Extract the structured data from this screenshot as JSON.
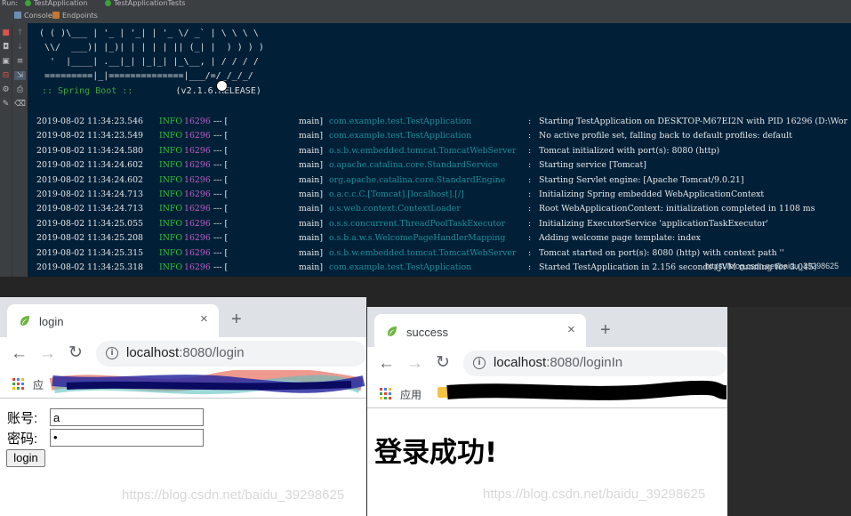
{
  "ide": {
    "run_label": "Run:",
    "run_tabs": [
      "TestApplication",
      "TestApplicationTests"
    ],
    "sub_tabs": [
      "Console",
      "Endpoints"
    ],
    "banner_lines": [
      "( ( )\\___ | '_ | '_| | '_ \\/ _` | \\ \\ \\ \\",
      " \\\\/  ___)| |_)| | | | | || (_| |  ) ) ) )",
      "  '  |____| .__|_| |_|_| |_\\__, | / / / /",
      " =========|_|==============|___/=/_/_/_/"
    ],
    "spring_label": ":: Spring Boot ::",
    "spring_version": "(v2.1.6.RELEASE)",
    "logs": [
      {
        "ts": "2019-08-02 11:34:23.546",
        "level": "INFO",
        "pid": "16296",
        "sep": "--- [",
        "thread": "main]",
        "logger": "com.example.test.TestApplication",
        "msg": "Starting TestApplication on DESKTOP-M67EI2N with PID 16296 (D:\\Wor"
      },
      {
        "ts": "2019-08-02 11:34:23.549",
        "level": "INFO",
        "pid": "16296",
        "sep": "--- [",
        "thread": "main]",
        "logger": "com.example.test.TestApplication",
        "msg": "No active profile set, falling back to default profiles: default"
      },
      {
        "ts": "2019-08-02 11:34:24.580",
        "level": "INFO",
        "pid": "16296",
        "sep": "--- [",
        "thread": "main]",
        "logger": "o.s.b.w.embedded.tomcat.TomcatWebServer",
        "msg": "Tomcat initialized with port(s): 8080 (http)"
      },
      {
        "ts": "2019-08-02 11:34:24.602",
        "level": "INFO",
        "pid": "16296",
        "sep": "--- [",
        "thread": "main]",
        "logger": "o.apache.catalina.core.StandardService",
        "msg": "Starting service [Tomcat]"
      },
      {
        "ts": "2019-08-02 11:34:24.602",
        "level": "INFO",
        "pid": "16296",
        "sep": "--- [",
        "thread": "main]",
        "logger": "org.apache.catalina.core.StandardEngine",
        "msg": "Starting Servlet engine: [Apache Tomcat/9.0.21]"
      },
      {
        "ts": "2019-08-02 11:34:24.713",
        "level": "INFO",
        "pid": "16296",
        "sep": "--- [",
        "thread": "main]",
        "logger": "o.a.c.c.C.[Tomcat].[localhost].[/]",
        "msg": "Initializing Spring embedded WebApplicationContext"
      },
      {
        "ts": "2019-08-02 11:34:24.713",
        "level": "INFO",
        "pid": "16296",
        "sep": "--- [",
        "thread": "main]",
        "logger": "o.s.web.context.ContextLoader",
        "msg": "Root WebApplicationContext: initialization completed in 1108 ms"
      },
      {
        "ts": "2019-08-02 11:34:25.055",
        "level": "INFO",
        "pid": "16296",
        "sep": "--- [",
        "thread": "main]",
        "logger": "o.s.s.concurrent.ThreadPoolTaskExecutor",
        "msg": "Initializing ExecutorService 'applicationTaskExecutor'"
      },
      {
        "ts": "2019-08-02 11:34:25.208",
        "level": "INFO",
        "pid": "16296",
        "sep": "--- [",
        "thread": "main]",
        "logger": "o.s.b.a.w.s.WelcomePageHandlerMapping",
        "msg": "Adding welcome page template: index"
      },
      {
        "ts": "2019-08-02 11:34:25.315",
        "level": "INFO",
        "pid": "16296",
        "sep": "--- [",
        "thread": "main]",
        "logger": "o.s.b.w.embedded.tomcat.TomcatWebServer",
        "msg": "Tomcat started on port(s): 8080 (http) with context path ''"
      },
      {
        "ts": "2019-08-02 11:34:25.318",
        "level": "INFO",
        "pid": "16296",
        "sep": "--- [",
        "thread": "main]",
        "logger": "com.example.test.TestApplication",
        "msg": "Started TestApplication in 2.156 seconds (JVM running for 3.045)"
      }
    ],
    "watermark": "https://blog.csdn.net/baidu_39298625"
  },
  "browser_left": {
    "tab_title": "login",
    "close_glyph": "×",
    "newtab_glyph": "+",
    "url_host": "localhost",
    "url_path": ":8080/login",
    "bookmark_label": "应",
    "form": {
      "account_label": "账号:",
      "account_value": "a",
      "password_label": "密码:",
      "password_value": "•",
      "submit_label": "login"
    },
    "watermark": "https://blog.csdn.net/baidu_39298625"
  },
  "browser_right": {
    "tab_title": "success",
    "close_glyph": "×",
    "newtab_glyph": "+",
    "url_host": "localhost",
    "url_path": ":8080/loginIn",
    "bookmark_label": "应用",
    "heading": "登录成功!",
    "watermark": "https://blog.csdn.net/baidu_39298625"
  },
  "colors": {
    "console_bg": "#012038",
    "info_green": "#2fbf3a",
    "pid_magenta": "#c15cc7",
    "logger_teal": "#1c8c97",
    "spring_green": "#3ca23c"
  }
}
